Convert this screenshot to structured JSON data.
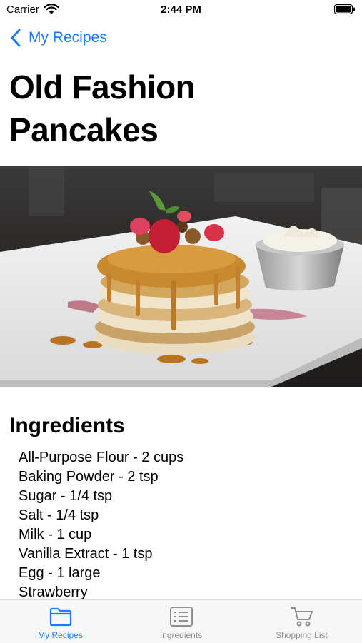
{
  "status_bar": {
    "carrier": "Carrier",
    "time": "2:44 PM"
  },
  "nav": {
    "back_label": "My Recipes"
  },
  "recipe": {
    "title": "Old Fashion Pancakes",
    "ingredients_heading": "Ingredients",
    "ingredients": [
      "All-Purpose Flour - 2 cups",
      "Baking Powder - 2 tsp",
      "Sugar - 1/4 tsp",
      "Salt - 1/4 tsp",
      "Milk - 1 cup",
      "Vanilla Extract - 1 tsp",
      "Egg - 1 large",
      "Strawberry"
    ]
  },
  "tab_bar": {
    "tabs": [
      {
        "label": "My Recipes",
        "icon": "folder-icon",
        "active": true
      },
      {
        "label": "Ingredients",
        "icon": "list-icon",
        "active": false
      },
      {
        "label": "Shopping List",
        "icon": "cart-icon",
        "active": false
      }
    ]
  },
  "colors": {
    "accent": "#1a7cf0",
    "inactive": "#8e8e93"
  }
}
